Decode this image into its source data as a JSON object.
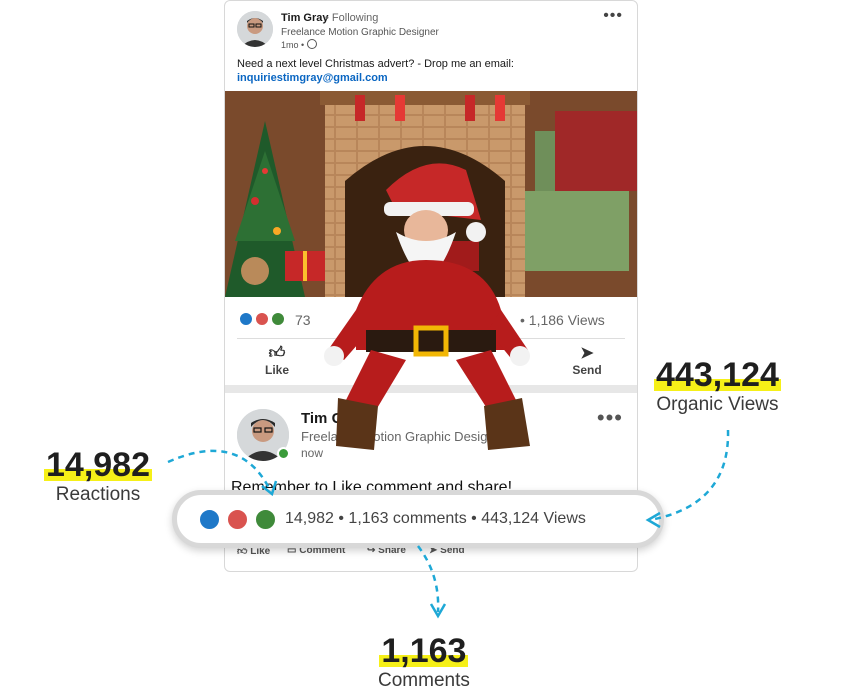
{
  "post1": {
    "author": "Tim Gray",
    "following": "• Following",
    "subtitle": "Freelance Motion Graphic Designer",
    "time": "1mo •",
    "more": "•••",
    "text": "Need a next level Christmas advert? - Drop me an email:",
    "email": "inquiriestimgray@gmail.com",
    "reaction_count": "73",
    "views": "• 1,186 Views",
    "actions": {
      "like": "Like",
      "send": "Send"
    }
  },
  "post2": {
    "author": "Tim Gray",
    "subtitle": "Freelance Motion Graphic Designer",
    "time": "now",
    "more": "•••",
    "text": "Remember to Like,comment and share!",
    "actions": {
      "like": "Like",
      "comment": "Comment",
      "share": "Share",
      "send": "Send"
    }
  },
  "highlight": {
    "stats": "14,982 • 1,163 comments • 443,124 Views"
  },
  "callouts": {
    "reactions": {
      "value": "14,982",
      "label": "Reactions"
    },
    "organic_views": {
      "value": "443,124",
      "label": "Organic Views"
    },
    "comments": {
      "value": "1,163",
      "label": "Comments"
    }
  },
  "colors": {
    "highlight": "#f6f018",
    "arrow": "#1ea8d6",
    "link": "#0a66c2",
    "like": "#1e78c8",
    "love": "#d9534f",
    "support": "#3f8a3a"
  }
}
